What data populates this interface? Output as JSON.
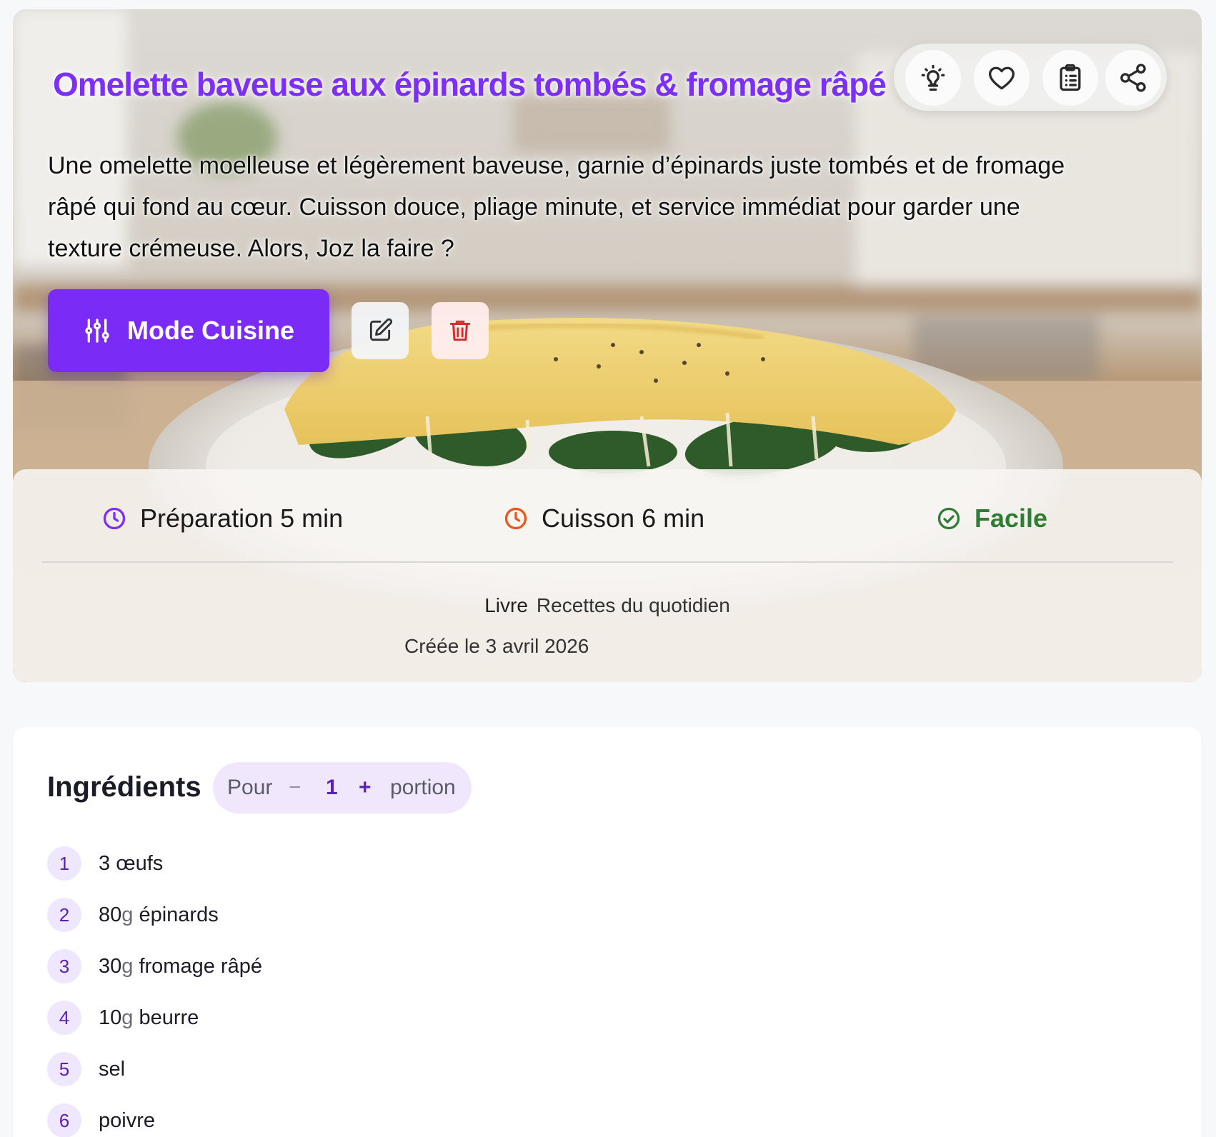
{
  "recipe": {
    "title": "Omelette baveuse aux épinards tombés & fromage râpé",
    "description": "Une omelette moelleuse et légèrement baveuse, garnie d’épinards juste tombés et de fromage râpé qui fond au cœur. Cuisson douce, pliage minute, et service immédiat pour garder une texture crémeuse. Alors, Joz la faire ?",
    "cook_mode_label": "Mode Cuisine",
    "actions": {
      "tips_icon": "lightbulb-icon",
      "favorite_icon": "heart-icon",
      "shopping_list_icon": "clipboard-list-icon",
      "share_icon": "share-icon",
      "edit_icon": "edit-icon",
      "delete_icon": "trash-icon"
    },
    "meta": {
      "prep_label": "Préparation 5 min",
      "cook_label": "Cuisson 6 min",
      "difficulty": "Facile",
      "book_label": "Livre",
      "book_name": "Recettes du quotidien",
      "created": "Créée le 3 avril 2026"
    }
  },
  "ingredients": {
    "title": "Ingrédients",
    "portion": {
      "prefix": "Pour",
      "minus": "−",
      "count": "1",
      "plus": "+",
      "unit": "portion"
    },
    "items": [
      {
        "num": "1",
        "qty": "3",
        "unit": "",
        "name": " œufs"
      },
      {
        "num": "2",
        "qty": "80",
        "unit": "g",
        "name": " épinards"
      },
      {
        "num": "3",
        "qty": "30",
        "unit": "g",
        "name": " fromage râpé"
      },
      {
        "num": "4",
        "qty": "10",
        "unit": "g",
        "name": " beurre"
      },
      {
        "num": "5",
        "qty": "",
        "unit": "",
        "name": "sel"
      },
      {
        "num": "6",
        "qty": "",
        "unit": "",
        "name": "poivre"
      }
    ]
  },
  "colors": {
    "accent": "#7a2bf5",
    "prep_icon": "#7b2ff7",
    "cook_icon": "#e8581c",
    "easy": "#2e7d32",
    "delete": "#d32f2f"
  }
}
